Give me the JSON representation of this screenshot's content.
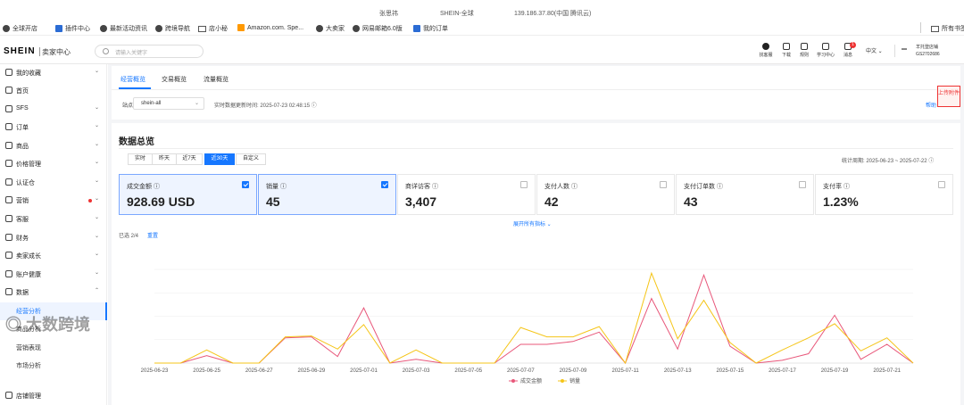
{
  "os_bar": {
    "user": "张思祎",
    "account": "SHEIN-全球",
    "ip": "139.186.37.80(中国 腾讯云)"
  },
  "bookmarks": {
    "items": [
      "全球开店",
      "插件中心",
      "最新活动资讯",
      "跨境导航",
      "店小秘",
      "Amazon.com. Spe...",
      "大卖家",
      "网易邮箱6.0版",
      "我的订单"
    ],
    "other": "所有书签"
  },
  "header": {
    "logo": "SHEIN",
    "subtitle": "卖家中心",
    "search_placeholder": "请输入关键字",
    "icons": [
      "找客服",
      "下载",
      "规则",
      "学习中心",
      "消息"
    ],
    "message_badge": "1",
    "language": "中文",
    "user_line1": "羊托登店铺",
    "user_line2": "GS2702686"
  },
  "sidebar": {
    "items": [
      {
        "label": "我的收藏",
        "chev": "⌄"
      },
      {
        "label": "首页",
        "chev": ""
      },
      {
        "label": "SFS",
        "chev": "⌄"
      },
      {
        "label": "订单",
        "chev": "⌄"
      },
      {
        "label": "商品",
        "chev": "⌄"
      },
      {
        "label": "价格管理",
        "chev": "⌄"
      },
      {
        "label": "认证仓",
        "chev": "⌄"
      },
      {
        "label": "营销",
        "chev": "⌄"
      },
      {
        "label": "客服",
        "chev": "⌄"
      },
      {
        "label": "财务",
        "chev": "⌄"
      },
      {
        "label": "卖家成长",
        "chev": "⌄"
      },
      {
        "label": "账户健康",
        "chev": "⌄"
      },
      {
        "label": "数据",
        "chev": "⌃"
      },
      {
        "label": "经营分析",
        "chev": ""
      },
      {
        "label": "商品分析",
        "chev": ""
      },
      {
        "label": "营销表现",
        "chev": ""
      },
      {
        "label": "市场分析",
        "chev": ""
      },
      {
        "label": "店铺管理",
        "chev": ""
      }
    ]
  },
  "tabs": [
    "经营概览",
    "交易概览",
    "流量概览"
  ],
  "filter": {
    "site_label": "站点",
    "site_value": "shein-all",
    "update_text": "实时数据更新时间: 2025-07-23 02:48:15 ⓘ",
    "help": "帮助"
  },
  "float_button": "上传附件",
  "overview": {
    "title": "数据总览",
    "ranges": [
      "实时",
      "昨天",
      "近7天",
      "近30天",
      "自定义"
    ],
    "active_range": "近30天",
    "period": "统计周期: 2025-06-23 ~ 2025-07-22 ⓘ",
    "cards": [
      {
        "label": "成交金额 ⓘ",
        "value": "928.69 USD",
        "checked": true
      },
      {
        "label": "销量 ⓘ",
        "value": "45",
        "checked": true
      },
      {
        "label": "商详访客 ⓘ",
        "value": "3,407",
        "checked": false
      },
      {
        "label": "支付人数 ⓘ",
        "value": "42",
        "checked": false
      },
      {
        "label": "支付订单数 ⓘ",
        "value": "43",
        "checked": false
      },
      {
        "label": "支付率 ⓘ",
        "value": "1.23%",
        "checked": false
      }
    ],
    "expand": "展开所有指标 ⌄",
    "selected": "已选 2/4",
    "reset": "重置"
  },
  "chart_data": {
    "type": "line",
    "x": [
      "2025-06-23",
      "2025-06-24",
      "2025-06-25",
      "2025-06-26",
      "2025-06-27",
      "2025-06-28",
      "2025-06-29",
      "2025-06-30",
      "2025-07-01",
      "2025-07-02",
      "2025-07-03",
      "2025-07-04",
      "2025-07-05",
      "2025-07-06",
      "2025-07-07",
      "2025-07-08",
      "2025-07-09",
      "2025-07-10",
      "2025-07-11",
      "2025-07-12",
      "2025-07-13",
      "2025-07-14",
      "2025-07-15",
      "2025-07-16",
      "2025-07-17",
      "2025-07-18",
      "2025-07-19",
      "2025-07-20",
      "2025-07-21",
      "2025-07-22"
    ],
    "x_tick_labels": [
      "2025-06-23",
      "2025-06-25",
      "2025-06-27",
      "2025-06-29",
      "2025-07-01",
      "2025-07-03",
      "2025-07-05",
      "2025-07-07",
      "2025-07-09",
      "2025-07-11",
      "2025-07-13",
      "2025-07-15",
      "2025-07-17",
      "2025-07-19",
      "2025-07-21"
    ],
    "series": [
      {
        "name": "成交金额",
        "color": "#e8577a",
        "values": [
          0,
          0,
          0.08,
          0,
          0,
          0.27,
          0.28,
          0.07,
          0.59,
          0,
          0.04,
          0,
          0,
          0,
          0.2,
          0.2,
          0.23,
          0.33,
          0,
          0.69,
          0.15,
          0.94,
          0.18,
          0,
          0.03,
          0.1,
          0.51,
          0.04,
          0.2,
          0
        ]
      },
      {
        "name": "销量",
        "color": "#f5c518",
        "values": [
          0,
          0,
          0.14,
          0,
          0,
          0.28,
          0.29,
          0.15,
          0.41,
          0,
          0.14,
          0,
          0,
          0,
          0.38,
          0.28,
          0.28,
          0.39,
          0,
          0.96,
          0.26,
          0.67,
          0.22,
          0,
          0.14,
          0.27,
          0.42,
          0.13,
          0.27,
          0
        ]
      }
    ],
    "ylim": [
      0,
      1
    ],
    "grid": true,
    "legend_position": "bottom-center"
  },
  "watermark": "大数跨境"
}
